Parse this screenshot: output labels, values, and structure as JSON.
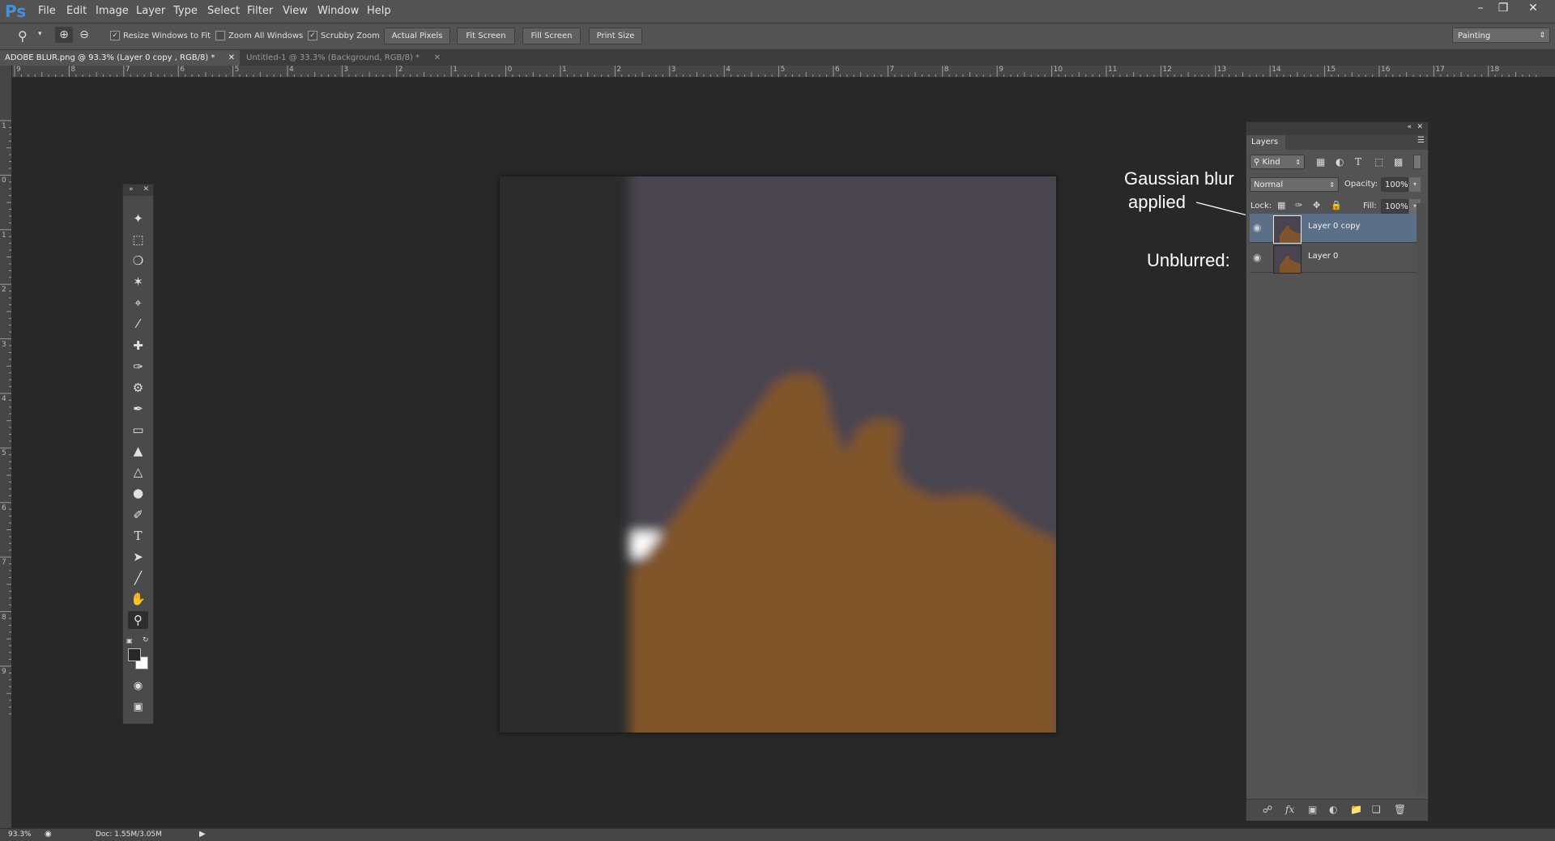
{
  "app": {
    "logo": "Ps"
  },
  "menu": [
    "File",
    "Edit",
    "Image",
    "Layer",
    "Type",
    "Select",
    "Filter",
    "View",
    "Window",
    "Help"
  ],
  "window_controls": {
    "minimize": "–",
    "restore": "❐",
    "close": "✕"
  },
  "options": {
    "zoom_tool_icon": "zoom-icon",
    "resize_windows_to_fit": {
      "label": "Resize Windows to Fit",
      "checked": true
    },
    "zoom_all_windows": {
      "label": "Zoom All Windows",
      "checked": false
    },
    "scrubby_zoom": {
      "label": "Scrubby Zoom",
      "checked": true
    },
    "actual_pixels": "Actual Pixels",
    "fit_screen": "Fit Screen",
    "fill_screen": "Fill Screen",
    "print_size": "Print Size",
    "workspace": "Painting"
  },
  "tabs": [
    {
      "label": "ADOBE BLUR.png @ 93.3% (Layer 0 copy , RGB/8) *",
      "active": true
    },
    {
      "label": "Untitled-1 @ 33.3% (Background, RGB/8) *",
      "active": false
    }
  ],
  "rulers": {
    "horizontal": [
      "9",
      "8",
      "7",
      "6",
      "5",
      "4",
      "3",
      "2",
      "1",
      "0",
      "1",
      "2",
      "3",
      "4",
      "5",
      "6",
      "7",
      "8",
      "9",
      "10",
      "11",
      "12",
      "13",
      "14",
      "15",
      "16",
      "17",
      "18"
    ],
    "vertical": [
      "1",
      "0",
      "1",
      "2",
      "3",
      "4",
      "5",
      "6",
      "7",
      "8",
      "9"
    ]
  },
  "annotations": {
    "blurred_line1": "Gaussian blur",
    "blurred_line2": "applied",
    "unblurred": "Unblurred:"
  },
  "layers_panel": {
    "title": "Layers",
    "filter": "Kind",
    "blend_mode": "Normal",
    "opacity_label": "Opacity:",
    "opacity_value": "100%",
    "lock_label": "Lock:",
    "fill_label": "Fill:",
    "fill_value": "100%",
    "layers": [
      {
        "name": "Layer 0 copy",
        "selected": true,
        "visible": true
      },
      {
        "name": "Layer 0",
        "selected": false,
        "visible": true
      }
    ]
  },
  "status": {
    "zoom": "93.3%",
    "doc": "Doc: 1.55M/3.05M"
  },
  "colors": {
    "background_purple": "#4a4450",
    "brown": "#80542c",
    "dark_strip": "#2c2c2c",
    "selected_layer": "#5b6f87"
  }
}
